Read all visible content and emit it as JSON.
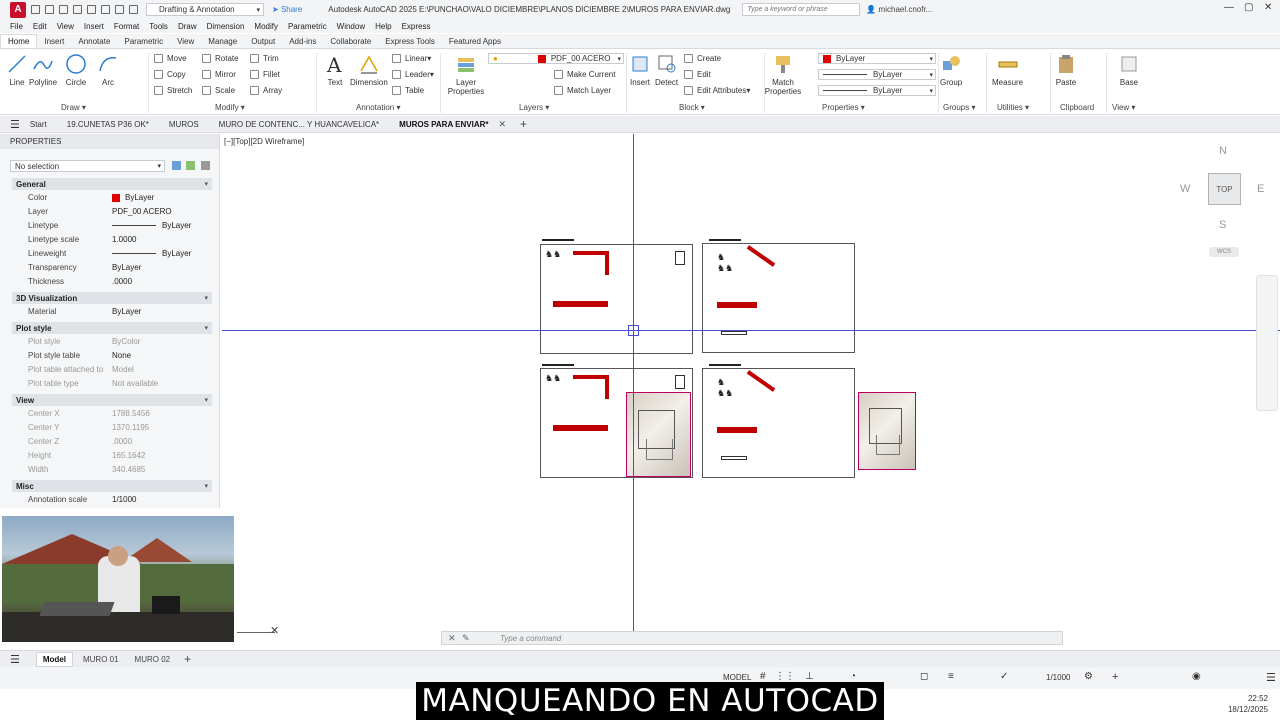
{
  "titlebar": {
    "workspace": "Drafting & Annotation",
    "share": "Share",
    "title": "Autodesk AutoCAD 2025   E:\\PUNCHAO\\VALO DICIEMBRE\\PLANOS DICIEMBRE 2\\MUROS PARA ENVIAR.dwg",
    "search_placeholder": "Type a keyword or phrase",
    "user": "michael.cnofr...",
    "app_logo": "A"
  },
  "menubar": [
    "File",
    "Edit",
    "View",
    "Insert",
    "Format",
    "Tools",
    "Draw",
    "Dimension",
    "Modify",
    "Parametric",
    "Window",
    "Help",
    "Express"
  ],
  "ribbon_tabs": [
    "Home",
    "Insert",
    "Annotate",
    "Parametric",
    "View",
    "Manage",
    "Output",
    "Add-ins",
    "Collaborate",
    "Express Tools",
    "Featured Apps"
  ],
  "ribbon": {
    "draw": {
      "title": "Draw",
      "line": "Line",
      "polyline": "Polyline",
      "circle": "Circle",
      "arc": "Arc"
    },
    "modify": {
      "title": "Modify",
      "move": "Move",
      "rotate": "Rotate",
      "trim": "Trim",
      "copy": "Copy",
      "mirror": "Mirror",
      "fillet": "Fillet",
      "stretch": "Stretch",
      "scale": "Scale",
      "array": "Array"
    },
    "annotation": {
      "title": "Annotation",
      "text": "Text",
      "dimension": "Dimension",
      "linear": "Linear",
      "leader": "Leader",
      "table": "Table"
    },
    "layers": {
      "title": "Layers",
      "layer_properties": "Layer Properties",
      "current_layer": "PDF_00 ACERO",
      "make_current": "Make Current",
      "match_layer": "Match Layer"
    },
    "block": {
      "title": "Block",
      "insert": "Insert",
      "detect": "Detect",
      "create": "Create",
      "edit": "Edit",
      "edit_attributes": "Edit Attributes"
    },
    "properties": {
      "title": "Properties",
      "match_properties": "Match Properties",
      "color": "ByLayer",
      "linetype": "ByLayer",
      "lineweight": "ByLayer"
    },
    "groups": {
      "title": "Groups",
      "group": "Group"
    },
    "utilities": {
      "title": "Utilities",
      "measure": "Measure"
    },
    "clipboard": {
      "title": "Clipboard",
      "paste": "Paste"
    },
    "view": {
      "title": "View",
      "base": "Base"
    }
  },
  "file_tabs": [
    "Start",
    "19.CUNETAS P36 OK*",
    "MUROS",
    "MURO DE CONTENC... Y HUANCAVELICA*",
    "MUROS PARA ENVIAR*"
  ],
  "properties_palette": {
    "header": "PROPERTIES",
    "selection": "No selection",
    "categories": {
      "general": {
        "title": "General",
        "rows": [
          {
            "name": "Color",
            "value": "ByLayer"
          },
          {
            "name": "Layer",
            "value": "PDF_00 ACERO"
          },
          {
            "name": "Linetype",
            "value": "ByLayer"
          },
          {
            "name": "Linetype scale",
            "value": "1.0000"
          },
          {
            "name": "Lineweight",
            "value": "ByLayer"
          },
          {
            "name": "Transparency",
            "value": "ByLayer"
          },
          {
            "name": "Thickness",
            "value": ".0000"
          }
        ]
      },
      "viz3d": {
        "title": "3D Visualization",
        "rows": [
          {
            "name": "Material",
            "value": "ByLayer"
          }
        ]
      },
      "plot": {
        "title": "Plot style",
        "rows": [
          {
            "name": "Plot style",
            "value": "ByColor"
          },
          {
            "name": "Plot style table",
            "value": "None"
          },
          {
            "name": "Plot table attached to",
            "value": "Model"
          },
          {
            "name": "Plot table type",
            "value": "Not available"
          }
        ]
      },
      "view": {
        "title": "View",
        "rows": [
          {
            "name": "Center X",
            "value": "1788.5456"
          },
          {
            "name": "Center Y",
            "value": "1370.1195"
          },
          {
            "name": "Center Z",
            "value": ".0000"
          },
          {
            "name": "Height",
            "value": "165.1642"
          },
          {
            "name": "Width",
            "value": "340.4685"
          }
        ]
      },
      "misc": {
        "title": "Misc",
        "rows": [
          {
            "name": "Annotation scale",
            "value": "1/1000"
          }
        ]
      }
    }
  },
  "viewport": {
    "label": "[−][Top][2D Wireframe]",
    "viewcube": {
      "face": "TOP",
      "n": "N",
      "s": "S",
      "e": "E",
      "w": "W",
      "wcs": "WCS"
    }
  },
  "command_line": {
    "placeholder": "Type a command"
  },
  "layout_tabs": [
    "Model",
    "MURO 01",
    "MURO 02"
  ],
  "statusbar": {
    "model": "MODEL",
    "scale": "1/1000"
  },
  "caption": "MANQUEANDO EN AUTOCAD",
  "clock": {
    "time": "22:52",
    "date": "18/12/2025"
  },
  "colors": {
    "accent": "#2a7bd1",
    "layer_red": "#e00000",
    "crosshair": "#4a4ad8"
  }
}
